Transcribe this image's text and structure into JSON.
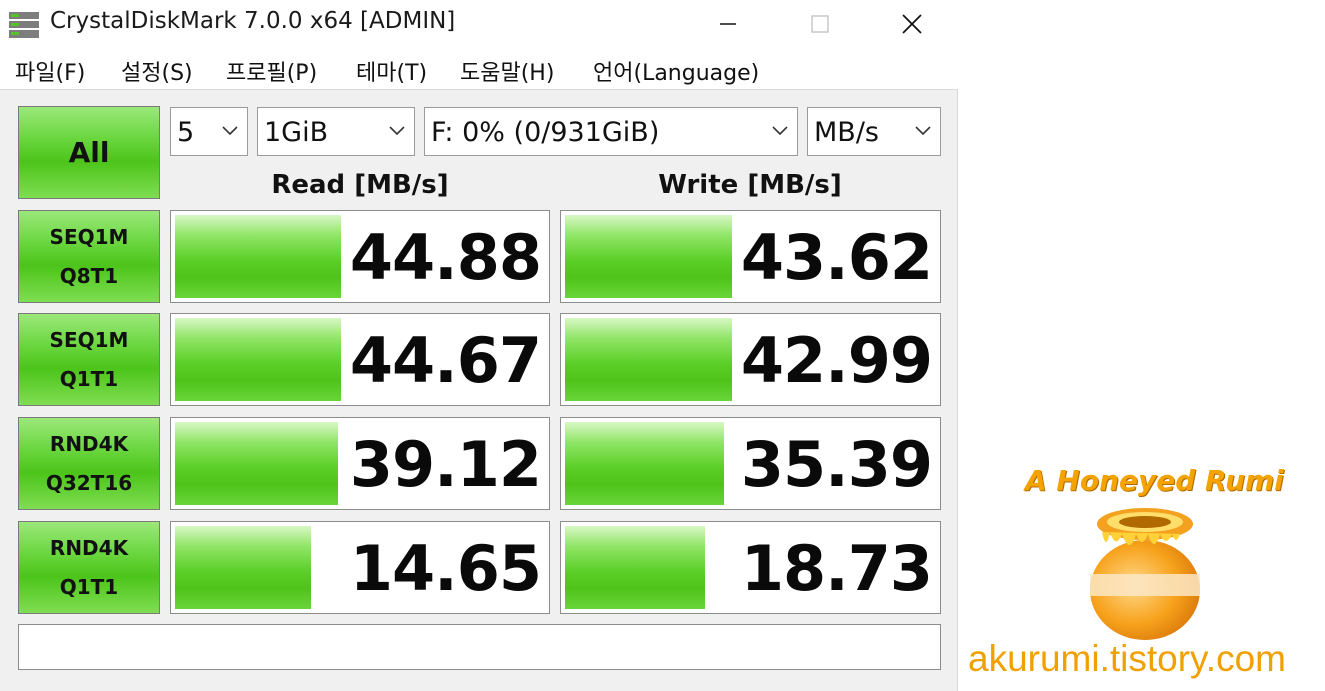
{
  "window": {
    "title": "CrystalDiskMark 7.0.0 x64 [ADMIN]",
    "controls": {
      "minimize": "minimize-icon",
      "maximize": "maximize-icon",
      "close": "close-icon"
    }
  },
  "menu": [
    "파일(F)",
    "설정(S)",
    "프로필(P)",
    "테마(T)",
    "도움말(H)",
    "언어(Language)"
  ],
  "toolbar": {
    "all_label": "All",
    "count": "5",
    "size": "1GiB",
    "drive": "F: 0% (0/931GiB)",
    "unit": "MB/s"
  },
  "headers": {
    "read": "Read [MB/s]",
    "write": "Write [MB/s]"
  },
  "tests": [
    {
      "line1": "SEQ1M",
      "line2": "Q8T1",
      "read": "44.88",
      "write": "43.62",
      "read_fill": 0.44,
      "write_fill": 0.44
    },
    {
      "line1": "SEQ1M",
      "line2": "Q1T1",
      "read": "44.67",
      "write": "42.99",
      "read_fill": 0.44,
      "write_fill": 0.44
    },
    {
      "line1": "RND4K",
      "line2": "Q32T16",
      "read": "39.12",
      "write": "35.39",
      "read_fill": 0.43,
      "write_fill": 0.42
    },
    {
      "line1": "RND4K",
      "line2": "Q1T1",
      "read": "14.65",
      "write": "18.73",
      "read_fill": 0.36,
      "write_fill": 0.37
    }
  ],
  "status_text": "",
  "watermark": {
    "title": "A Honeyed Rumi",
    "url": "akurumi.tistory.com"
  },
  "colors": {
    "accent_green": "#4cc41a",
    "watermark_orange": "#f5a300"
  }
}
